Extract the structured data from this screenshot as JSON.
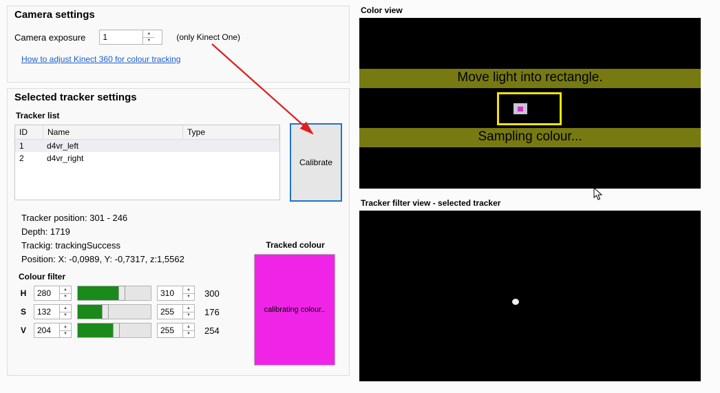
{
  "camera": {
    "title": "Camera settings",
    "exposure_label": "Camera exposure",
    "exposure_value": "1",
    "kinect_note": "(only Kinect One)",
    "help_link": "How to adjust Kinect 360 for colour tracking"
  },
  "tracker": {
    "title": "Selected tracker settings",
    "list_title": "Tracker list",
    "columns": {
      "id": "ID",
      "name": "Name",
      "type": "Type"
    },
    "rows": [
      {
        "id": "1",
        "name": "d4vr_left",
        "type": ""
      },
      {
        "id": "2",
        "name": "d4vr_right",
        "type": ""
      }
    ],
    "calibrate": "Calibrate",
    "readouts": {
      "pos": "Tracker position: 301 - 246",
      "depth": "Depth: 1719",
      "status": "Trackig: trackingSuccess",
      "xyz": "Position: X: -0,0989, Y: -0,7317, z:1,5562"
    }
  },
  "colour_filter": {
    "title": "Colour filter",
    "rows": {
      "H": {
        "label": "H",
        "low": "280",
        "high": "310",
        "readout": "300",
        "fill_pct": 58,
        "knob_pct": 58
      },
      "S": {
        "label": "S",
        "low": "132",
        "high": "255",
        "readout": "176",
        "fill_pct": 35,
        "knob_pct": 35
      },
      "V": {
        "label": "V",
        "low": "204",
        "high": "255",
        "readout": "254",
        "fill_pct": 50,
        "knob_pct": 50
      }
    }
  },
  "tracked_colour": {
    "title": "Tracked colour",
    "status": "calibrating colour..",
    "hex": "#ef24e6"
  },
  "color_view": {
    "title": "Color view",
    "instruction": "Move light into rectangle.",
    "sampling": "Sampling colour..."
  },
  "filter_view": {
    "title": "Tracker filter view - selected tracker"
  }
}
